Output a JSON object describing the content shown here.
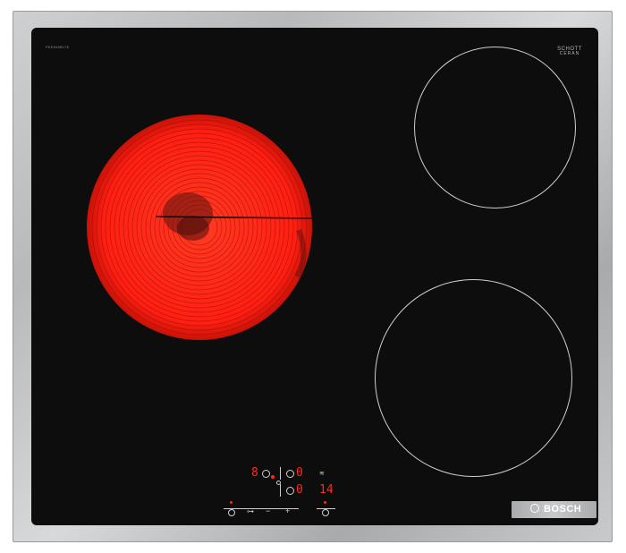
{
  "hob": {
    "model_label": "PKE645B17E",
    "glass_brand": {
      "line1": "SCHOTT",
      "line2": "CERAN",
      "line3": ""
    },
    "brand_name": "BOSCH"
  },
  "controls": {
    "top_left_level": "8",
    "top_right_level": "0",
    "top_mid_level": "0",
    "bottom_left_level": "0",
    "timer_value": "14"
  },
  "colors": {
    "glass": "#0d0d0e",
    "frame": "#c0c1c3",
    "heating_red": "#ff2a1a",
    "zone_outline": "#cfcfcf"
  },
  "icons": [
    "power-icon",
    "child-lock-icon",
    "minus-icon",
    "plus-icon",
    "timer-icon",
    "bosch-logo-icon"
  ]
}
